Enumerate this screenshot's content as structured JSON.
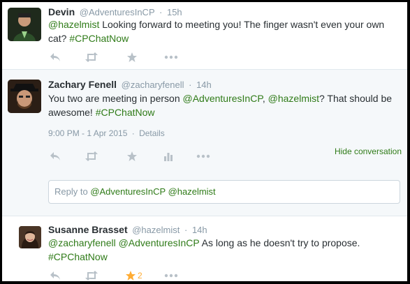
{
  "tweets": [
    {
      "fullname": "Devin",
      "screen_name": "@AdventuresInCP",
      "time": "15h",
      "text_parts": {
        "mention": "@hazelmist",
        "text": " Looking forward to meeting you! The finger wasn't even your own cat?",
        "hashtag": "#CPChatNow"
      },
      "avatar_icon": "user-avatar-icon"
    },
    {
      "fullname": "Zachary Fenell",
      "screen_name": "@zacharyfenell",
      "time": "14h",
      "text_parts": {
        "text1": "You two are meeting in person ",
        "mention1": "@AdventuresInCP",
        "sep": ", ",
        "mention2": "@hazelmist",
        "text2": "? That should be awesome! ",
        "hashtag": "#CPChatNow"
      },
      "timestamp": "9:00 PM - 1 Apr 2015",
      "details_label": "Details",
      "hide_conversation_label": "Hide conversation",
      "reply_box": {
        "prefix": "Reply to ",
        "mention1": "@AdventuresInCP",
        "mention2": "@hazelmist"
      }
    },
    {
      "fullname": "Susanne Brasset",
      "screen_name": "@hazelmist",
      "time": "14h",
      "text_parts": {
        "mention1": "@zacharyfenell",
        "mention2": "@AdventuresInCP",
        "text": " As long as he doesn't try to propose.",
        "hashtag": "#CPChatNow"
      },
      "favorite_count": "2"
    }
  ],
  "separator_dot": "·",
  "colors": {
    "link": "#2b7bb9",
    "hashtag": "#3b8a0f",
    "star_active": "#ffac33",
    "muted": "#8899a6"
  },
  "icons": [
    "reply-icon",
    "retweet-icon",
    "favorite-icon",
    "more-icon",
    "analytics-icon"
  ]
}
